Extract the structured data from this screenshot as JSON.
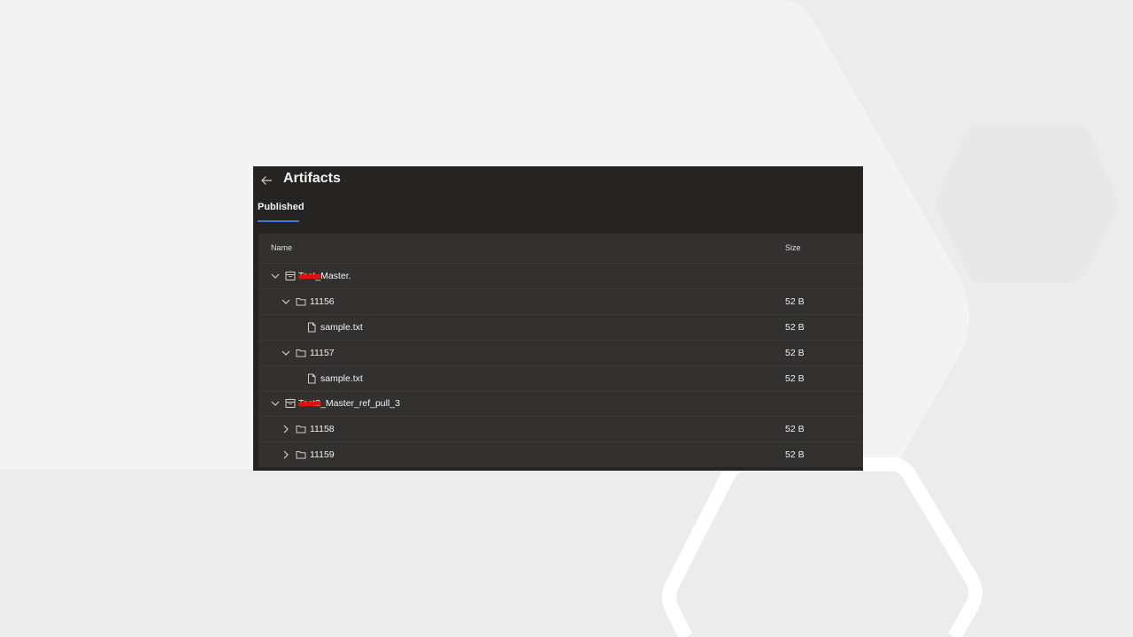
{
  "page": {
    "title": "Artifacts"
  },
  "tabs": [
    {
      "label": "Published",
      "selected": true
    }
  ],
  "table": {
    "columns": {
      "name": "Name",
      "size": "Size"
    },
    "rows": [
      {
        "name": "Test_Master.",
        "size": "",
        "kind": "artifact",
        "expanded": true,
        "level": 0
      },
      {
        "name": "11156",
        "size": "52 B",
        "kind": "folder",
        "expanded": true,
        "level": 1
      },
      {
        "name": "sample.txt",
        "size": "52 B",
        "kind": "file",
        "level": 2
      },
      {
        "name": "11157",
        "size": "52 B",
        "kind": "folder",
        "expanded": true,
        "level": 1
      },
      {
        "name": "sample.txt",
        "size": "52 B",
        "kind": "file",
        "level": 2
      },
      {
        "name": "Test2_Master_ref_pull_3",
        "size": "",
        "kind": "artifact",
        "expanded": true,
        "level": 0
      },
      {
        "name": "11158",
        "size": "52 B",
        "kind": "folder",
        "expanded": false,
        "level": 1
      },
      {
        "name": "11159",
        "size": "52 B",
        "kind": "folder",
        "expanded": false,
        "level": 1
      }
    ]
  },
  "colors": {
    "panel": "#252423",
    "table": "#323130",
    "accent": "#3c7ad8",
    "redaction": "#e01010",
    "background": "#ececec"
  },
  "icons": {
    "back": "arrow-left-icon",
    "artifact": "archive-icon",
    "folder": "folder-icon",
    "file": "file-icon",
    "expanded": "chevron-down-icon",
    "collapsed": "chevron-right-icon"
  }
}
